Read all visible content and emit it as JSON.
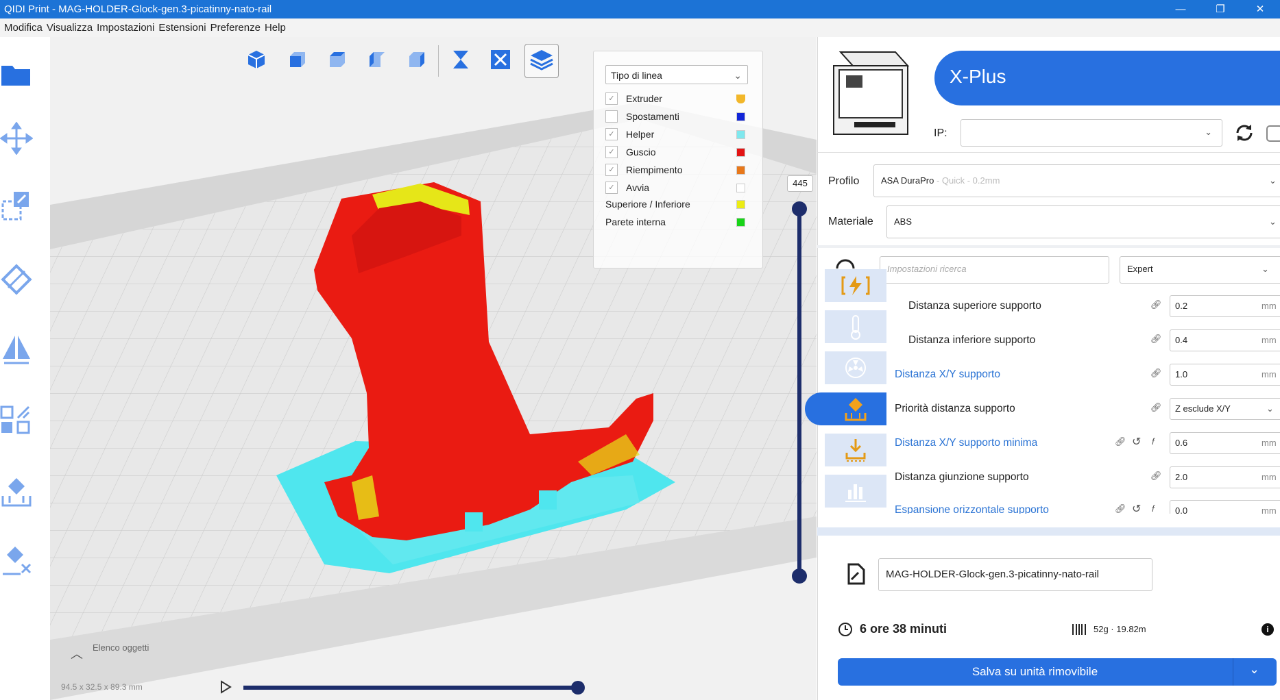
{
  "window": {
    "title": "QIDI Print - MAG-HOLDER-Glock-gen.3-picatinny-nato-rail",
    "controls": [
      "—",
      "❐",
      "✕"
    ]
  },
  "menu": [
    "Modifica",
    "Visualizza",
    "Impostazioni",
    "Estensioni",
    "Preferenze",
    "Help"
  ],
  "legend": {
    "selector": "Tipo di linea",
    "items": [
      {
        "label": "Extruder",
        "checked": true,
        "color": "#f2b72a"
      },
      {
        "label": "Spostamenti",
        "checked": false,
        "color": "#1226d8"
      },
      {
        "label": "Helper",
        "checked": true,
        "color": "#7fe8ee"
      },
      {
        "label": "Guscio",
        "checked": true,
        "color": "#e31414"
      },
      {
        "label": "Riempimento",
        "checked": true,
        "color": "#e8781a"
      },
      {
        "label": "Avvia",
        "checked": true,
        "color": "#ffffff"
      },
      {
        "label": "Superiore / Inferiore",
        "color": "#ecec14"
      },
      {
        "label": "Parete interna",
        "color": "#18d418"
      }
    ]
  },
  "layer_slider": {
    "value": "445"
  },
  "viewport": {
    "objects_list": "Elenco oggetti",
    "dimensions": "94.5 x 32.5 x 89.3 mm"
  },
  "printer": {
    "name": "X-Plus",
    "ip_label": "IP:",
    "ip_value": ""
  },
  "profile": {
    "label": "Profilo",
    "value": "ASA DuraPro",
    "hint": " - Quick - 0.2mm"
  },
  "material": {
    "label": "Materiale",
    "value": "ABS"
  },
  "search": {
    "placeholder": "Impostazioni ricerca",
    "mode": "Expert"
  },
  "settings": [
    {
      "label": "Distanza superiore supporto",
      "value": "0.2",
      "unit": "mm",
      "blue": false,
      "indent": true
    },
    {
      "label": "Distanza inferiore supporto",
      "value": "0.4",
      "unit": "mm",
      "blue": false,
      "indent": true
    },
    {
      "label": "Distanza X/Y supporto",
      "value": "1.0",
      "unit": "mm",
      "blue": true,
      "indent": false
    },
    {
      "label": "Priorità distanza supporto",
      "value": "Z esclude X/Y",
      "unit": "",
      "blue": false,
      "indent": false
    },
    {
      "label": "Distanza X/Y supporto minima",
      "value": "0.6",
      "unit": "mm",
      "blue": true,
      "indent": false
    },
    {
      "label": "Distanza giunzione supporto",
      "value": "2.0",
      "unit": "mm",
      "blue": false,
      "indent": false
    },
    {
      "label": "Espansione orizzontale supporto",
      "value": "0.0",
      "unit": "mm",
      "blue": true,
      "indent": false
    }
  ],
  "job": {
    "filename": "MAG-HOLDER-Glock-gen.3-picatinny-nato-rail",
    "time": "6 ore 38 minuti",
    "material_usage": "52g · 19.82m",
    "save_button": "Salva su unità rimovibile"
  },
  "colors": {
    "accent": "#2870e0",
    "titlebar": "#1c73d6",
    "shell": "#ea1b12",
    "support": "#4fe6ee",
    "topbottom": "#e6e618"
  }
}
